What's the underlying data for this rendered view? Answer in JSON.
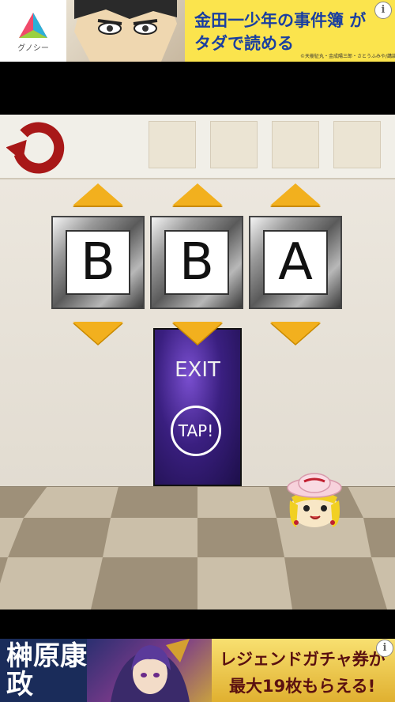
{
  "ad_top": {
    "logo_label": "グノシー",
    "line1": "金田一少年の事件簿 が",
    "line2": "タダで読める",
    "copyright": "©天樹征丸・金成陽三郎・さとうふみや/講談社",
    "info_glyph": "i"
  },
  "game": {
    "back_icon": "undo-circle-arrow-icon",
    "inventory_slots": [
      "",
      "",
      "",
      ""
    ],
    "letters": [
      "B",
      "B",
      "A"
    ],
    "door": {
      "label": "EXIT",
      "button": "TAP!"
    },
    "colors": {
      "arrow": "#f2b01e",
      "back_arrow": "#a81818",
      "door": "#3a1f80"
    }
  },
  "ad_bottom": {
    "name": "榊原康政",
    "promo_line1": "レジェンドガチャ券が",
    "promo_line2": "最大19枚もらえる!",
    "info_glyph": "i"
  }
}
